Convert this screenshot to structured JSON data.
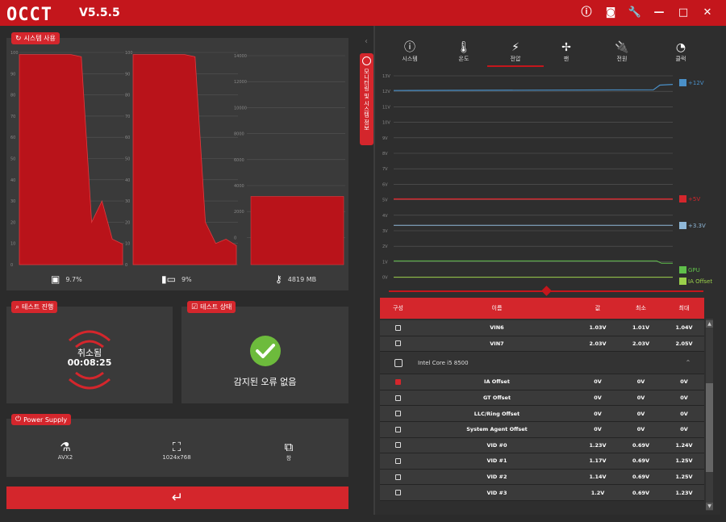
{
  "app": {
    "logo": "OCCT",
    "version": "V5.5.5"
  },
  "titlebar_icons": [
    {
      "name": "info-icon",
      "glyph": "ⓘ"
    },
    {
      "name": "camera-icon",
      "glyph": "◙"
    },
    {
      "name": "wrench-icon",
      "glyph": "🔧"
    },
    {
      "name": "minimize-icon",
      "glyph": "—"
    },
    {
      "name": "maximize-icon",
      "glyph": "□"
    },
    {
      "name": "close-icon",
      "glyph": "✕"
    }
  ],
  "usage": {
    "title": "시스템 사용",
    "cpu_axis": [
      "100",
      "90",
      "80",
      "70",
      "60",
      "50",
      "40",
      "30",
      "20",
      "10",
      "0"
    ],
    "mem_axis": [
      "14000",
      "12000",
      "10000",
      "8000",
      "6000",
      "4000",
      "2000",
      "0"
    ],
    "cpu_label": "9.7%",
    "mem_label": "9%",
    "ram_label": "4819 MB",
    "cpu_values": [
      99,
      99,
      99,
      99,
      99,
      99,
      98,
      20,
      30,
      12,
      9.7
    ],
    "cpu2_values": [
      99,
      99,
      99,
      99,
      99,
      99,
      98,
      20,
      10,
      12,
      9
    ],
    "ram_value_mb": 4819,
    "ram_max_mb": 15000
  },
  "test_progress": {
    "title": "테스트 진행",
    "status": "취소됨",
    "time": "00:08:25"
  },
  "test_status": {
    "title": "테스트 상태",
    "message": "감지된 오류 없음"
  },
  "power_supply": {
    "title": "Power Supply",
    "items": [
      {
        "icon": "flask-icon",
        "glyph": "⚗",
        "label": "AVX2"
      },
      {
        "icon": "fullscreen-icon",
        "glyph": "⛶",
        "label": "1024x768"
      },
      {
        "icon": "window-icon",
        "glyph": "⧉",
        "label": "창"
      }
    ]
  },
  "enter_button": "↵",
  "side_tab": {
    "label": "모니터링 및 시스템 정보"
  },
  "tabs": [
    {
      "label": "시스템",
      "glyph": "ⓘ",
      "icon": "info-icon"
    },
    {
      "label": "온도",
      "glyph": "🌡",
      "icon": "thermometer-icon"
    },
    {
      "label": "전압",
      "glyph": "⚡",
      "icon": "battery-bolt-icon"
    },
    {
      "label": "팬",
      "glyph": "✢",
      "icon": "fan-icon"
    },
    {
      "label": "전원",
      "glyph": "🔌",
      "icon": "plug-icon"
    },
    {
      "label": "클럭",
      "glyph": "◔",
      "icon": "gauge-icon"
    }
  ],
  "active_tab": "전압",
  "voltage_axis": [
    "13V",
    "12V",
    "11V",
    "10V",
    "9V",
    "8V",
    "7V",
    "6V",
    "5V",
    "4V",
    "3V",
    "2V",
    "1V",
    "0V"
  ],
  "voltage_legend": [
    {
      "label": "+12V",
      "color": "#4a90c8"
    },
    {
      "label": "+5V",
      "color": "#d4262c"
    },
    {
      "label": "+3.3V",
      "color": "#8fb8d8"
    },
    {
      "label": "GPU",
      "color": "#5fbf4a"
    },
    {
      "label": "IA Offset",
      "color": "#9ad04a"
    }
  ],
  "table": {
    "headers": [
      "구성",
      "이름",
      "값",
      "최소",
      "최대"
    ],
    "rows": [
      {
        "type": "row",
        "checked": false,
        "name": "VIN6",
        "value": "1.03V",
        "min": "1.01V",
        "max": "1.04V"
      },
      {
        "type": "row",
        "checked": false,
        "name": "VIN7",
        "value": "2.03V",
        "min": "2.03V",
        "max": "2.05V"
      },
      {
        "type": "group",
        "name": "Intel Core i5 8500"
      },
      {
        "type": "row",
        "checked": true,
        "name": "IA Offset",
        "value": "0V",
        "min": "0V",
        "max": "0V"
      },
      {
        "type": "row",
        "checked": false,
        "name": "GT Offset",
        "value": "0V",
        "min": "0V",
        "max": "0V"
      },
      {
        "type": "row",
        "checked": false,
        "name": "LLC/Ring Offset",
        "value": "0V",
        "min": "0V",
        "max": "0V"
      },
      {
        "type": "row",
        "checked": false,
        "name": "System Agent Offset",
        "value": "0V",
        "min": "0V",
        "max": "0V"
      },
      {
        "type": "row",
        "checked": false,
        "name": "VID #0",
        "value": "1.23V",
        "min": "0.69V",
        "max": "1.24V"
      },
      {
        "type": "row",
        "checked": false,
        "name": "VID #1",
        "value": "1.17V",
        "min": "0.69V",
        "max": "1.25V"
      },
      {
        "type": "row",
        "checked": false,
        "name": "VID #2",
        "value": "1.14V",
        "min": "0.69V",
        "max": "1.25V"
      },
      {
        "type": "row",
        "checked": false,
        "name": "VID #3",
        "value": "1.2V",
        "min": "0.69V",
        "max": "1.23V"
      }
    ]
  }
}
